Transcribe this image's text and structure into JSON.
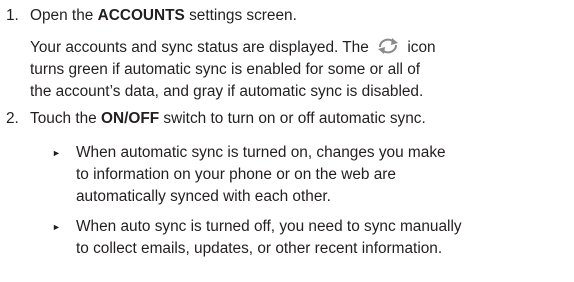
{
  "steps": [
    {
      "number": "1.",
      "pre": "Open the ",
      "bold": "ACCOUNTS",
      "post": " settings screen.",
      "para": {
        "line1_pre": "Your accounts and sync status are displayed. The",
        "line1_post": "icon",
        "line2": "turns green if automatic sync is enabled for some or all of",
        "line3": "the account’s data, and gray if automatic sync is disabled."
      }
    },
    {
      "number": "2.",
      "pre": "Touch the ",
      "bold": "ON/OFF",
      "post": " switch to turn on or off automatic sync.",
      "bullets": [
        {
          "marker": "►",
          "lines": [
            "When automatic sync is turned on, changes you make",
            "to information on your phone or on the web are",
            "automatically synced with each other."
          ]
        },
        {
          "marker": "►",
          "lines": [
            "When auto sync is turned off, you need to sync manually",
            "to collect emails, updates, or other recent information."
          ]
        }
      ]
    }
  ],
  "icons": {
    "sync": "sync-icon",
    "sync_color": "#8a8a8a"
  }
}
